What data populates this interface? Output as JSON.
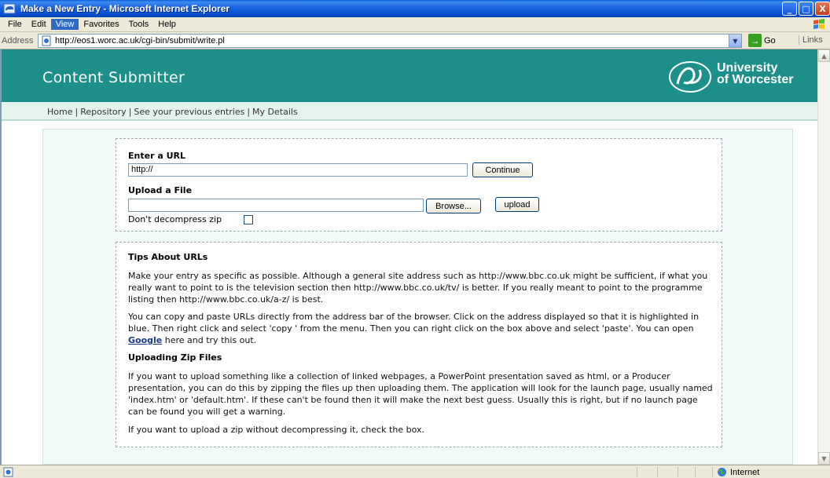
{
  "window": {
    "title": "Make a New Entry - Microsoft Internet Explorer",
    "min_glyph": "_",
    "max_glyph": "□",
    "close_glyph": "X"
  },
  "menu": {
    "items": [
      {
        "label": "File"
      },
      {
        "label": "Edit"
      },
      {
        "label": "View"
      },
      {
        "label": "Favorites"
      },
      {
        "label": "Tools"
      },
      {
        "label": "Help"
      }
    ]
  },
  "address_bar": {
    "label": "Address",
    "url": "http://eos1.worc.ac.uk/cgi-bin/submit/write.pl",
    "go_label": "Go",
    "links_label": "Links",
    "dropdown_glyph": "▼",
    "go_glyph": "→"
  },
  "site": {
    "title": "Content Submitter",
    "logo_line1": "University",
    "logo_line2": "of Worcester",
    "nav": {
      "home": "Home",
      "repository": "Repository",
      "previous": "See your previous entries",
      "details": "My Details",
      "separator": "|"
    }
  },
  "form": {
    "url_label": "Enter a URL",
    "url_value": "http://",
    "continue_label": "Continue",
    "upload_label": "Upload a File",
    "file_value": "",
    "browse_label": "Browse...",
    "upload_button": "upload",
    "nodecompress_label": "Don't decompress zip"
  },
  "tips": {
    "urls_heading": "Tips About URLs",
    "p1": "Make your entry as specific as possible. Although a general site address such as http://www.bbc.co.uk might be sufficient, if what you really want to point to is the television section then http://www.bbc.co.uk/tv/ is better. If you really meant to point to the programme listing then http://www.bbc.co.uk/a-z/ is best.",
    "p2_before": "You can copy and paste URLs directly from the address bar of the browser. Click on the address displayed so that it is highlighted in blue. Then right click and select 'copy ' from the menu. Then you can right click on the box above and select 'paste'. You can open ",
    "p2_link": "Google",
    "p2_after": " here and try this out.",
    "zip_heading": "Uploading Zip Files",
    "p3": "If you want to upload something like a collection of linked webpages, a PowerPoint presentation saved as html, or a Producer presentation, you can do this by zipping the files up then uploading them. The application will look for the launch page, usually named 'index.htm' or 'default.htm'. If these can't be found then it will make the next best guess. Usually this is right, but if no launch page can be found you will get a warning.",
    "p4": "If you want to upload a zip without decompressing it, check the box."
  },
  "status": {
    "zone": "Internet"
  },
  "scrollbar": {
    "up_glyph": "▲",
    "down_glyph": "▼"
  },
  "colors": {
    "header_bg": "#1d8f8b",
    "nav_bg": "#e4f3ec",
    "xp_title": "#0b4fd0"
  },
  "icons": [
    "ie-icon",
    "windows-flag-icon",
    "page-icon",
    "go-arrow-icon",
    "university-logo-icon",
    "status-page-icon",
    "globe-icon"
  ]
}
